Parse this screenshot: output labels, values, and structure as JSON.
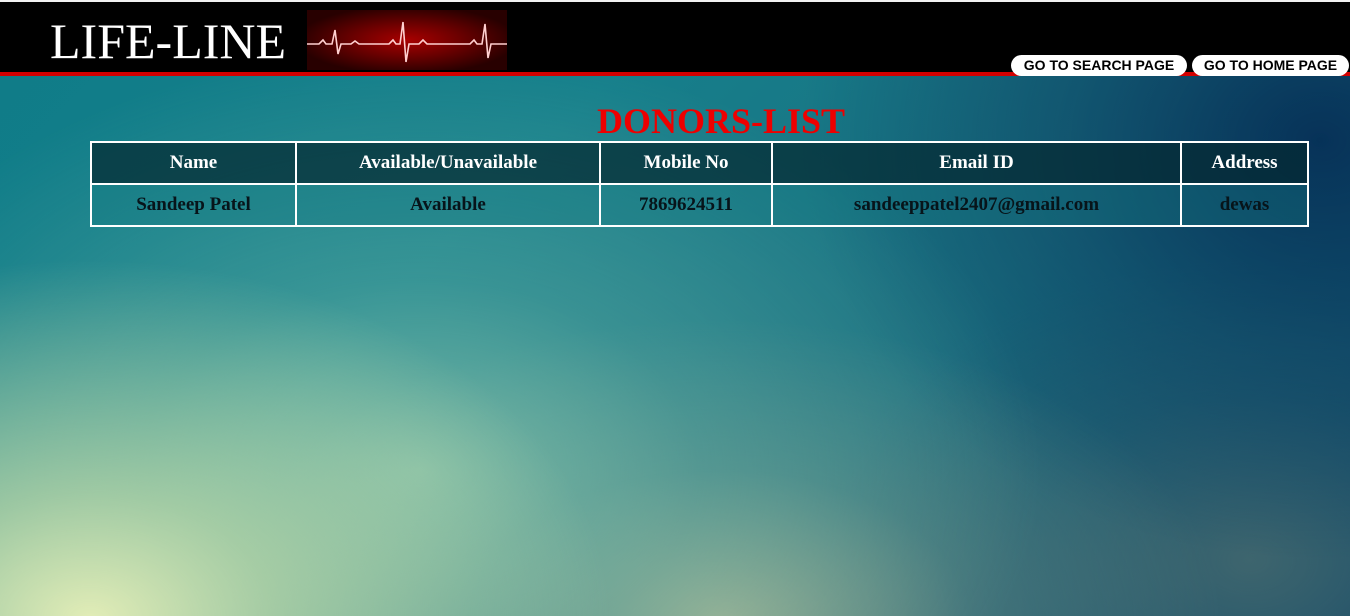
{
  "header": {
    "logo_text": "LIFE-LINE",
    "logo_graphic": "ecg-heartbeat",
    "buttons": {
      "search": "GO TO SEARCH PAGE",
      "home": "GO TO HOME PAGE"
    }
  },
  "page_title": "DONORS-LIST",
  "table": {
    "columns": [
      "Name",
      "Available/Unavailable",
      "Mobile No",
      "Email ID",
      "Address"
    ],
    "rows": [
      [
        "Sandeep Patel",
        "Available",
        "7869624511",
        "sandeeppatel2407@gmail.com",
        "dewas"
      ]
    ]
  },
  "colors": {
    "header_bg": "#000000",
    "header_rule": "#d30000",
    "title": "#ee0000"
  }
}
